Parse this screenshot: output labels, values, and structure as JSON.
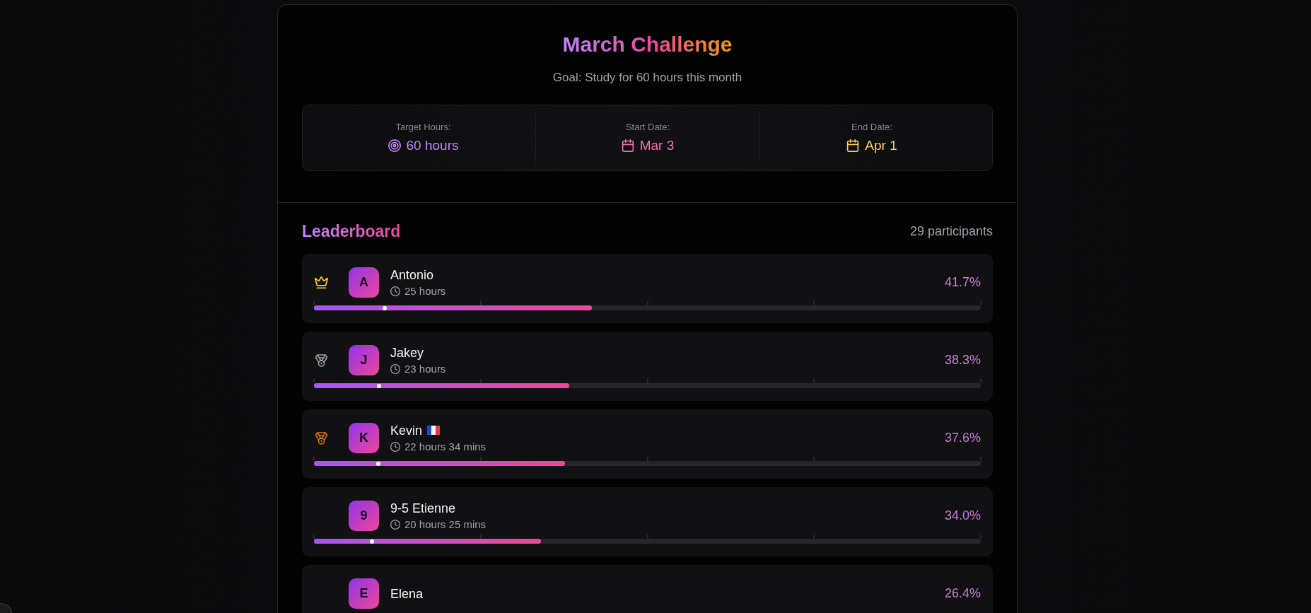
{
  "challenge": {
    "title": "March Challenge",
    "goal": "Goal: Study for 60 hours this month",
    "stats": [
      {
        "kind": "target",
        "label": "Target Hours:",
        "value": "60 hours",
        "color": "#c084fc"
      },
      {
        "kind": "calendar",
        "label": "Start Date:",
        "value": "Mar 3",
        "color": "#f472b6"
      },
      {
        "kind": "calendar",
        "label": "End Date:",
        "value": "Apr 1",
        "color": "#fcd34d"
      }
    ]
  },
  "leaderboard": {
    "title": "Leaderboard",
    "participants": "29 participants",
    "rows": [
      {
        "badge": {
          "kind": "crown",
          "color": "#facc15"
        },
        "initial": "A",
        "name": "Antonio",
        "flag": false,
        "time": "25 hours",
        "percent": "41.7%",
        "progress": {
          "level": 0.417
        },
        "marker": {
          "level": 0.106
        }
      },
      {
        "badge": {
          "kind": "medal",
          "color": "#9ca3af"
        },
        "initial": "J",
        "name": "Jakey",
        "flag": false,
        "time": "23 hours",
        "percent": "38.3%",
        "progress": {
          "level": 0.383
        },
        "marker": {
          "level": 0.098
        }
      },
      {
        "badge": {
          "kind": "medal",
          "color": "#d97706"
        },
        "initial": "K",
        "name": "Kevin",
        "flag": true,
        "time": "22 hours 34 mins",
        "percent": "37.6%",
        "progress": {
          "level": 0.376
        },
        "marker": {
          "level": 0.096
        }
      },
      {
        "initial": "9",
        "name": "9-5 Etienne",
        "flag": false,
        "time": "20 hours 25 mins",
        "percent": "34.0%",
        "progress": {
          "level": 0.34
        },
        "marker": {
          "level": 0.087
        }
      },
      {
        "initial": "E",
        "name": "Elena",
        "flag": false,
        "percent": "26.4%"
      }
    ]
  }
}
